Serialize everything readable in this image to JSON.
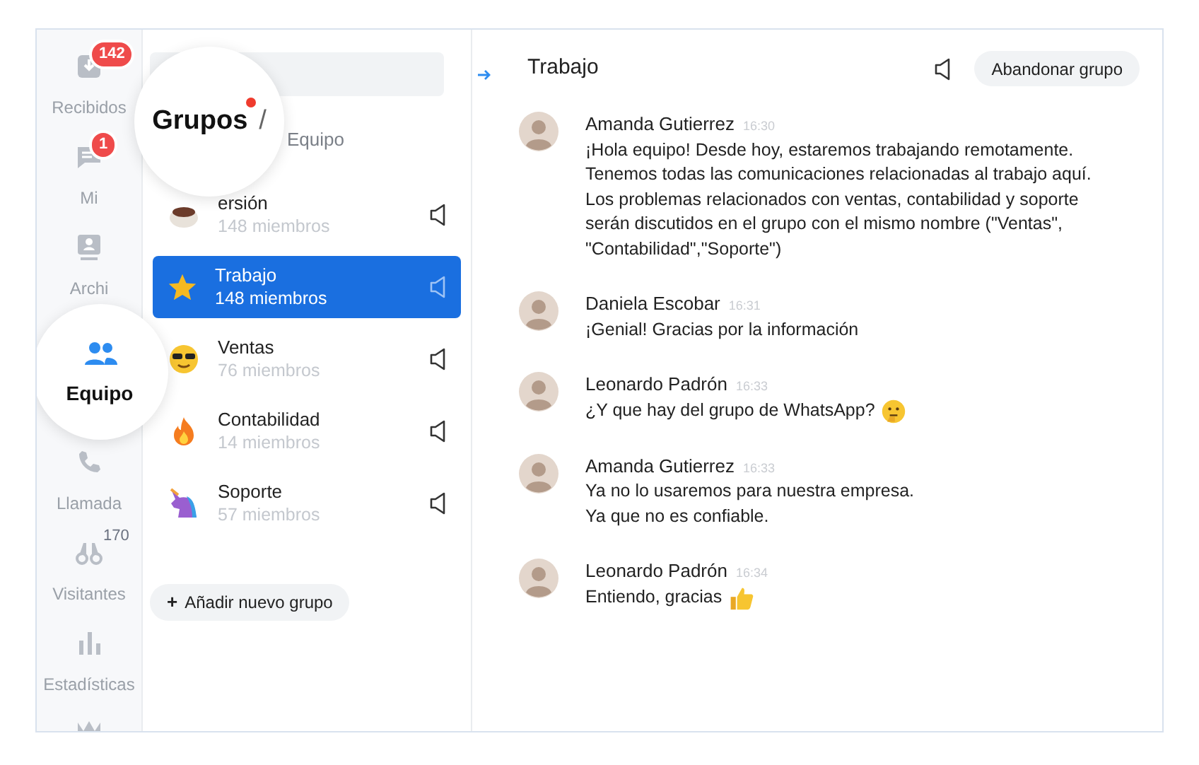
{
  "sidebar": {
    "items": [
      {
        "label": "Recibidos",
        "kind": "inbox",
        "badge": "142",
        "selected": false
      },
      {
        "label": "Mi",
        "kind": "chat",
        "badge": "1",
        "selected": false
      },
      {
        "label": "Archi",
        "kind": "archive",
        "selected": false
      },
      {
        "label": "Equipo",
        "kind": "team",
        "selected": true
      },
      {
        "label": "Llamada",
        "kind": "phone",
        "selected": false
      },
      {
        "label": "Visitantes",
        "kind": "visitors",
        "count": "170",
        "selected": false
      },
      {
        "label": "Estadísticas",
        "kind": "stats",
        "selected": false
      },
      {
        "kind": "crown",
        "selected": false
      }
    ]
  },
  "breadcrumb": {
    "current": "Grupos",
    "separator": "/",
    "parent": "Equipo"
  },
  "groups": [
    {
      "name": "ersión",
      "members": "148 miembros",
      "kind": "coffee",
      "selected": false
    },
    {
      "name": "Trabajo",
      "members": "148 miembros",
      "kind": "star",
      "selected": true
    },
    {
      "name": "Ventas",
      "members": "76 miembros",
      "kind": "cool",
      "selected": false
    },
    {
      "name": "Contabilidad",
      "members": "14 miembros",
      "kind": "fire",
      "selected": false
    },
    {
      "name": "Soporte",
      "members": "57 miembros",
      "kind": "unicorn",
      "selected": false
    }
  ],
  "add_group_button": {
    "icon": "+",
    "label": "Añadir nuevo grupo"
  },
  "chat": {
    "title": "Trabajo",
    "leave_button": "Abandonar grupo",
    "messages": [
      {
        "author": "Amanda Gutierrez",
        "time": "16:30",
        "kind": "plain",
        "lines": [
          "¡Hola equipo! Desde hoy, estaremos trabajando remotamente. Tenemos todas las comunicaciones relacionadas al trabajo aquí. Los problemas relacionados con ventas, contabilidad y soporte serán discutidos en el grupo con el mismo nombre (\"Ventas\", \"Contabilidad\",\"Soporte\")"
        ]
      },
      {
        "author": "Daniela Escobar",
        "time": "16:31",
        "kind": "plain",
        "lines": [
          "¡Genial! Gracias por la información"
        ]
      },
      {
        "author": "Leonardo Padrón",
        "time": "16:33",
        "kind": "thinking",
        "lines": [
          "¿Y que hay del grupo de WhatsApp?"
        ]
      },
      {
        "author": "Amanda Gutierrez",
        "time": "16:33",
        "kind": "plain",
        "lines": [
          "Ya no lo usaremos para nuestra empresa.",
          "Ya que no es confiable."
        ]
      },
      {
        "author": "Leonardo Padrón",
        "time": "16:34",
        "kind": "thumbs",
        "lines": [
          "Entiendo, gracias"
        ]
      }
    ]
  }
}
